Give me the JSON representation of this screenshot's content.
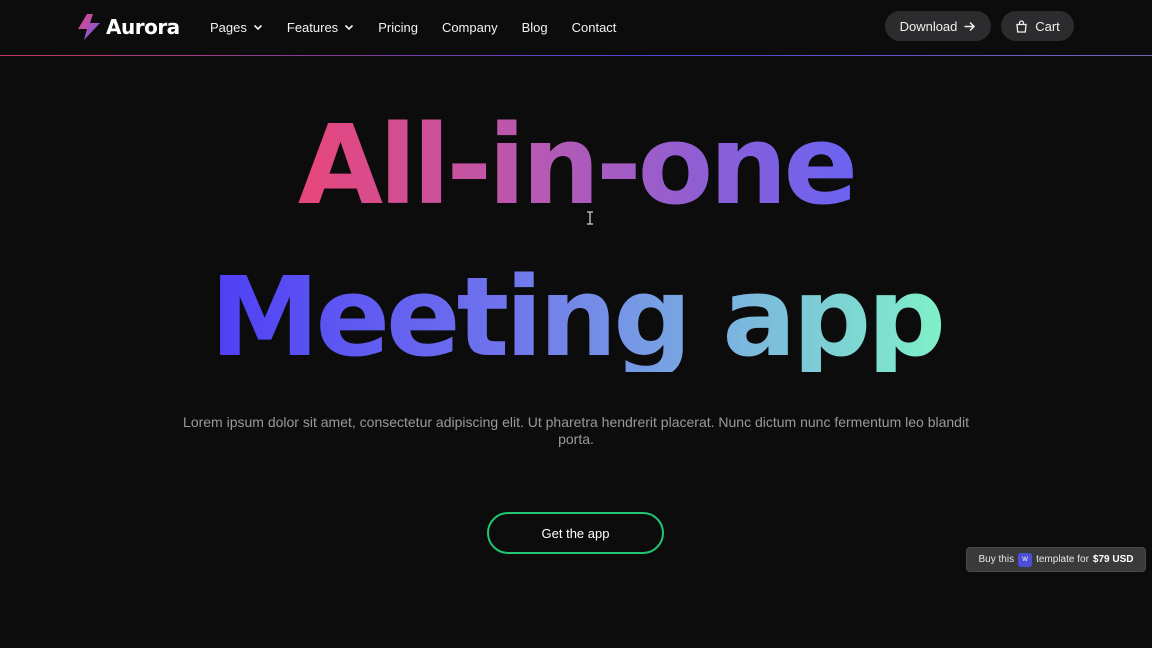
{
  "brand": {
    "name": "Aurora",
    "icon": "lightning-bolt-icon"
  },
  "nav": {
    "items": [
      {
        "label": "Pages",
        "has_dropdown": true
      },
      {
        "label": "Features",
        "has_dropdown": true
      },
      {
        "label": "Pricing",
        "has_dropdown": false
      },
      {
        "label": "Company",
        "has_dropdown": false
      },
      {
        "label": "Blog",
        "has_dropdown": false
      },
      {
        "label": "Contact",
        "has_dropdown": false
      }
    ],
    "download_label": "Download",
    "download_icon": "arrow-right-icon",
    "cart_label": "Cart",
    "cart_icon": "shopping-bag-icon"
  },
  "hero": {
    "line1": "All-in-one",
    "line2": "Meeting app",
    "subtitle": "Lorem ipsum dolor sit amet, consectetur adipiscing elit. Ut pharetra hendrerit placerat. Nunc dictum nunc fermentum leo blandit porta.",
    "cta_label": "Get the app"
  },
  "badge": {
    "prefix": "Buy this",
    "logo_text": "W",
    "middle": "template for",
    "price": "$79 USD"
  },
  "colors": {
    "background": "#0c0c0c",
    "accent_pink": "#e8467a",
    "accent_blue": "#4f3ff6",
    "accent_mint": "#7ff0c8",
    "cta_border": "#22c572",
    "pill_bg": "#2c2c2e"
  }
}
